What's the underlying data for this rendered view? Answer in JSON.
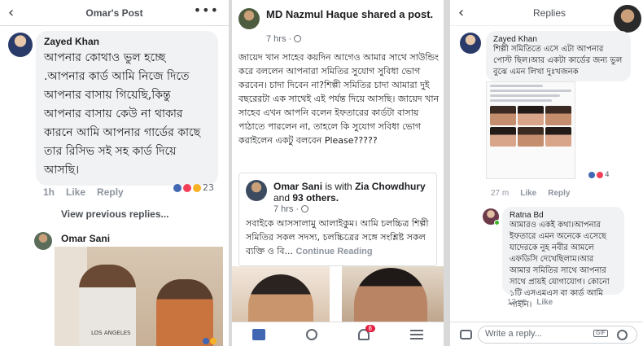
{
  "left": {
    "header_title": "Omar's Post",
    "back_icon": "‹",
    "more_icon": "•••",
    "comment": {
      "author": "Zayed Khan",
      "text": "আপনার কোথাও ভুল হচ্ছে .আপনার কার্ড আমি নিজে দিতে আপনার বাসায় গিয়েছি,কিন্তু আপনার বাসায় কেউ না থাকার কারনে আমি আপনার গার্ডের কাছে তার রিসিভ সই সহ কার্ড দিয়ে আসছি।",
      "time": "1h",
      "like": "Like",
      "reply": "Reply",
      "reaction_count": "23"
    },
    "view_previous": "View previous replies...",
    "reply_author": "Omar Sani",
    "photo_label": "LOS ANGELES"
  },
  "middle": {
    "post_header": "MD Nazmul Haque shared a post.",
    "post_time": "7 hrs ·",
    "post_text": "জায়েদ খান সাহেব কয়দিন আগেও আমার সাথে সাউন্ডিং করে বললেন আপনারা সমিতির সুযোগ সুবিধা ভোগ করবেন। চাদা দিবেন না?শিল্পী সমিতির চাদা আমারা দুই বছরেরটা এক সাথেই এই পর্যন্ত দিয়ে আসছি। জায়েদ খান সাহেব এখন আপনি বলেন ইফতারের কার্ডটা বাসায় পাঠাতে পারলেন না, তাহলে কি সুযোগ সবিধা ভোগ করাইলেন একটু বলবেন Please?????",
    "shared": {
      "author": "Omar Sani",
      "with_text": "is with",
      "with_name": "Zia Chowdhury",
      "and_text": "and",
      "others": "93 others.",
      "time": "7 hrs ·",
      "text": "সবাইকে আসসালামু আলাইকুম। আমি চলচ্চিত্র শিল্পী সমিতির সকল সদস্য, চলচ্চিত্রের সঙ্গে সংশ্লিষ্ট সকল ব্যক্তি ও বি...",
      "continue": "Continue Reading"
    },
    "notification_badge": "8"
  },
  "right": {
    "header_title": "Replies",
    "back_icon": "‹",
    "reply1": {
      "author": "Zayed Khan",
      "text": "শিল্পী সমিতিতে এসে এটা আপনার পোস্ট ছিল।আর একটা কার্ডের জন্য ভুল বুঝে এমন লিখা দুঃখজনক",
      "time": "27 m",
      "like": "Like",
      "reply": "Reply",
      "reaction_count": "4"
    },
    "reply2": {
      "author": "Ratna Bd",
      "text": "আমারও একই কথা।আপনার ইফতারে এমন অনেকে এসেছে যাদেরকে নুহ নবীর আমলে এফডিসি দেখেছিলাম।আর আমার সমিতির সাথে আপনার সাথে প্রায়ই যোগাযোগ। কোনো ১টি এসএমএস বা কার্ড আমি পাইনি।",
      "time": "13 m",
      "like": "Like"
    },
    "reply_placeholder": "Write a reply...",
    "gif_label": "GIF"
  },
  "colors": {
    "bubble": "#f1f2f4",
    "like_blue": "#4267b2",
    "love_red": "#f33e58",
    "haha_yellow": "#f7b125",
    "badge_red": "#e41e3f"
  }
}
